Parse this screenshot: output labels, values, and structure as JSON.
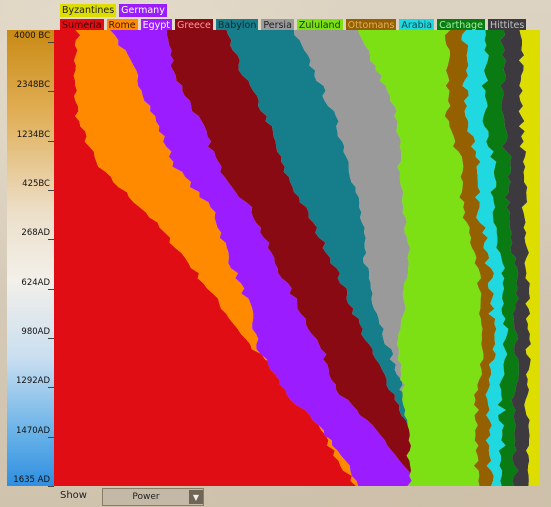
{
  "legend": [
    [
      {
        "name": "Byzantines",
        "color": "#dddd00",
        "text": "#222222"
      },
      {
        "name": "Germany",
        "color": "#9b1dff",
        "text": "#ffffff"
      }
    ],
    [
      {
        "name": "Sumeria",
        "color": "#e00d14",
        "text": "#3a0000"
      },
      {
        "name": "Rome",
        "color": "#ff8a00",
        "text": "#3a1a00"
      },
      {
        "name": "Egypt",
        "color": "#9b1dff",
        "text": "#ffffff"
      },
      {
        "name": "Greece",
        "color": "#8a0a14",
        "text": "#ff9a9a"
      },
      {
        "name": "Babylon",
        "color": "#167d8a",
        "text": "#0a2a2e"
      },
      {
        "name": "Persia",
        "color": "#9a9a9a",
        "text": "#222222"
      },
      {
        "name": "Zululand",
        "color": "#7de015",
        "text": "#1a3a00"
      },
      {
        "name": "Ottomans",
        "color": "#946000",
        "text": "#e0b060"
      },
      {
        "name": "Arabia",
        "color": "#20d8e0",
        "text": "#0a4a50"
      },
      {
        "name": "Carthage",
        "color": "#0a7a12",
        "text": "#a0f0a0"
      },
      {
        "name": "Hittites",
        "color": "#3d3a3f",
        "text": "#c0c0c0"
      }
    ]
  ],
  "timeline_labels": [
    "4000 BC",
    "2348BC",
    "1234BC",
    "425BC",
    "268AD",
    "624AD",
    "980AD",
    "1292AD",
    "1470AD",
    "1635 AD"
  ],
  "controls": {
    "show_label": "Show",
    "show_value": "Power"
  },
  "colors": {
    "Sumeria": "#e00d14",
    "Rome": "#ff8a00",
    "Egypt": "#9b1dff",
    "Greece": "#8a0a14",
    "Babylon": "#167d8a",
    "Persia": "#9a9a9a",
    "Zululand": "#7de015",
    "Ottomans": "#946000",
    "Arabia": "#20d8e0",
    "Carthage": "#0a7a12",
    "Hittites": "#3d3a3f",
    "Byzantines": "#dddd00"
  },
  "chart_data": {
    "type": "area",
    "order": [
      "Sumeria",
      "Rome",
      "Egypt",
      "Greece",
      "Babylon",
      "Persia",
      "Zululand",
      "Ottomans",
      "Arabia",
      "Carthage",
      "Hittites",
      "Byzantines"
    ],
    "x": [
      "4000 BC",
      "2348BC",
      "1234BC",
      "425BC",
      "268AD",
      "624AD",
      "980AD",
      "1292AD",
      "1470AD",
      "1635 AD"
    ],
    "boundaries": [
      [
        5,
        4,
        5,
        9,
        19,
        27,
        34,
        41,
        52,
        56,
        62
      ],
      [
        12,
        17,
        21,
        25,
        33,
        36,
        40,
        42,
        48,
        57,
        63
      ],
      [
        23,
        25,
        30,
        34,
        41,
        45,
        50,
        55,
        59,
        68,
        75
      ],
      [
        35,
        39,
        44,
        47,
        52,
        57,
        61,
        65,
        70,
        74,
        79
      ],
      [
        49,
        54,
        58,
        61,
        63,
        64,
        66,
        69,
        72,
        79,
        83
      ],
      [
        62,
        67,
        71,
        71,
        72,
        73,
        72,
        71,
        72,
        73,
        73
      ],
      [
        81,
        81,
        81,
        84,
        84,
        87,
        88,
        88,
        87,
        87,
        87
      ]
    ],
    "boundaries_note": "",
    "ylim": [
      0,
      100
    ]
  }
}
